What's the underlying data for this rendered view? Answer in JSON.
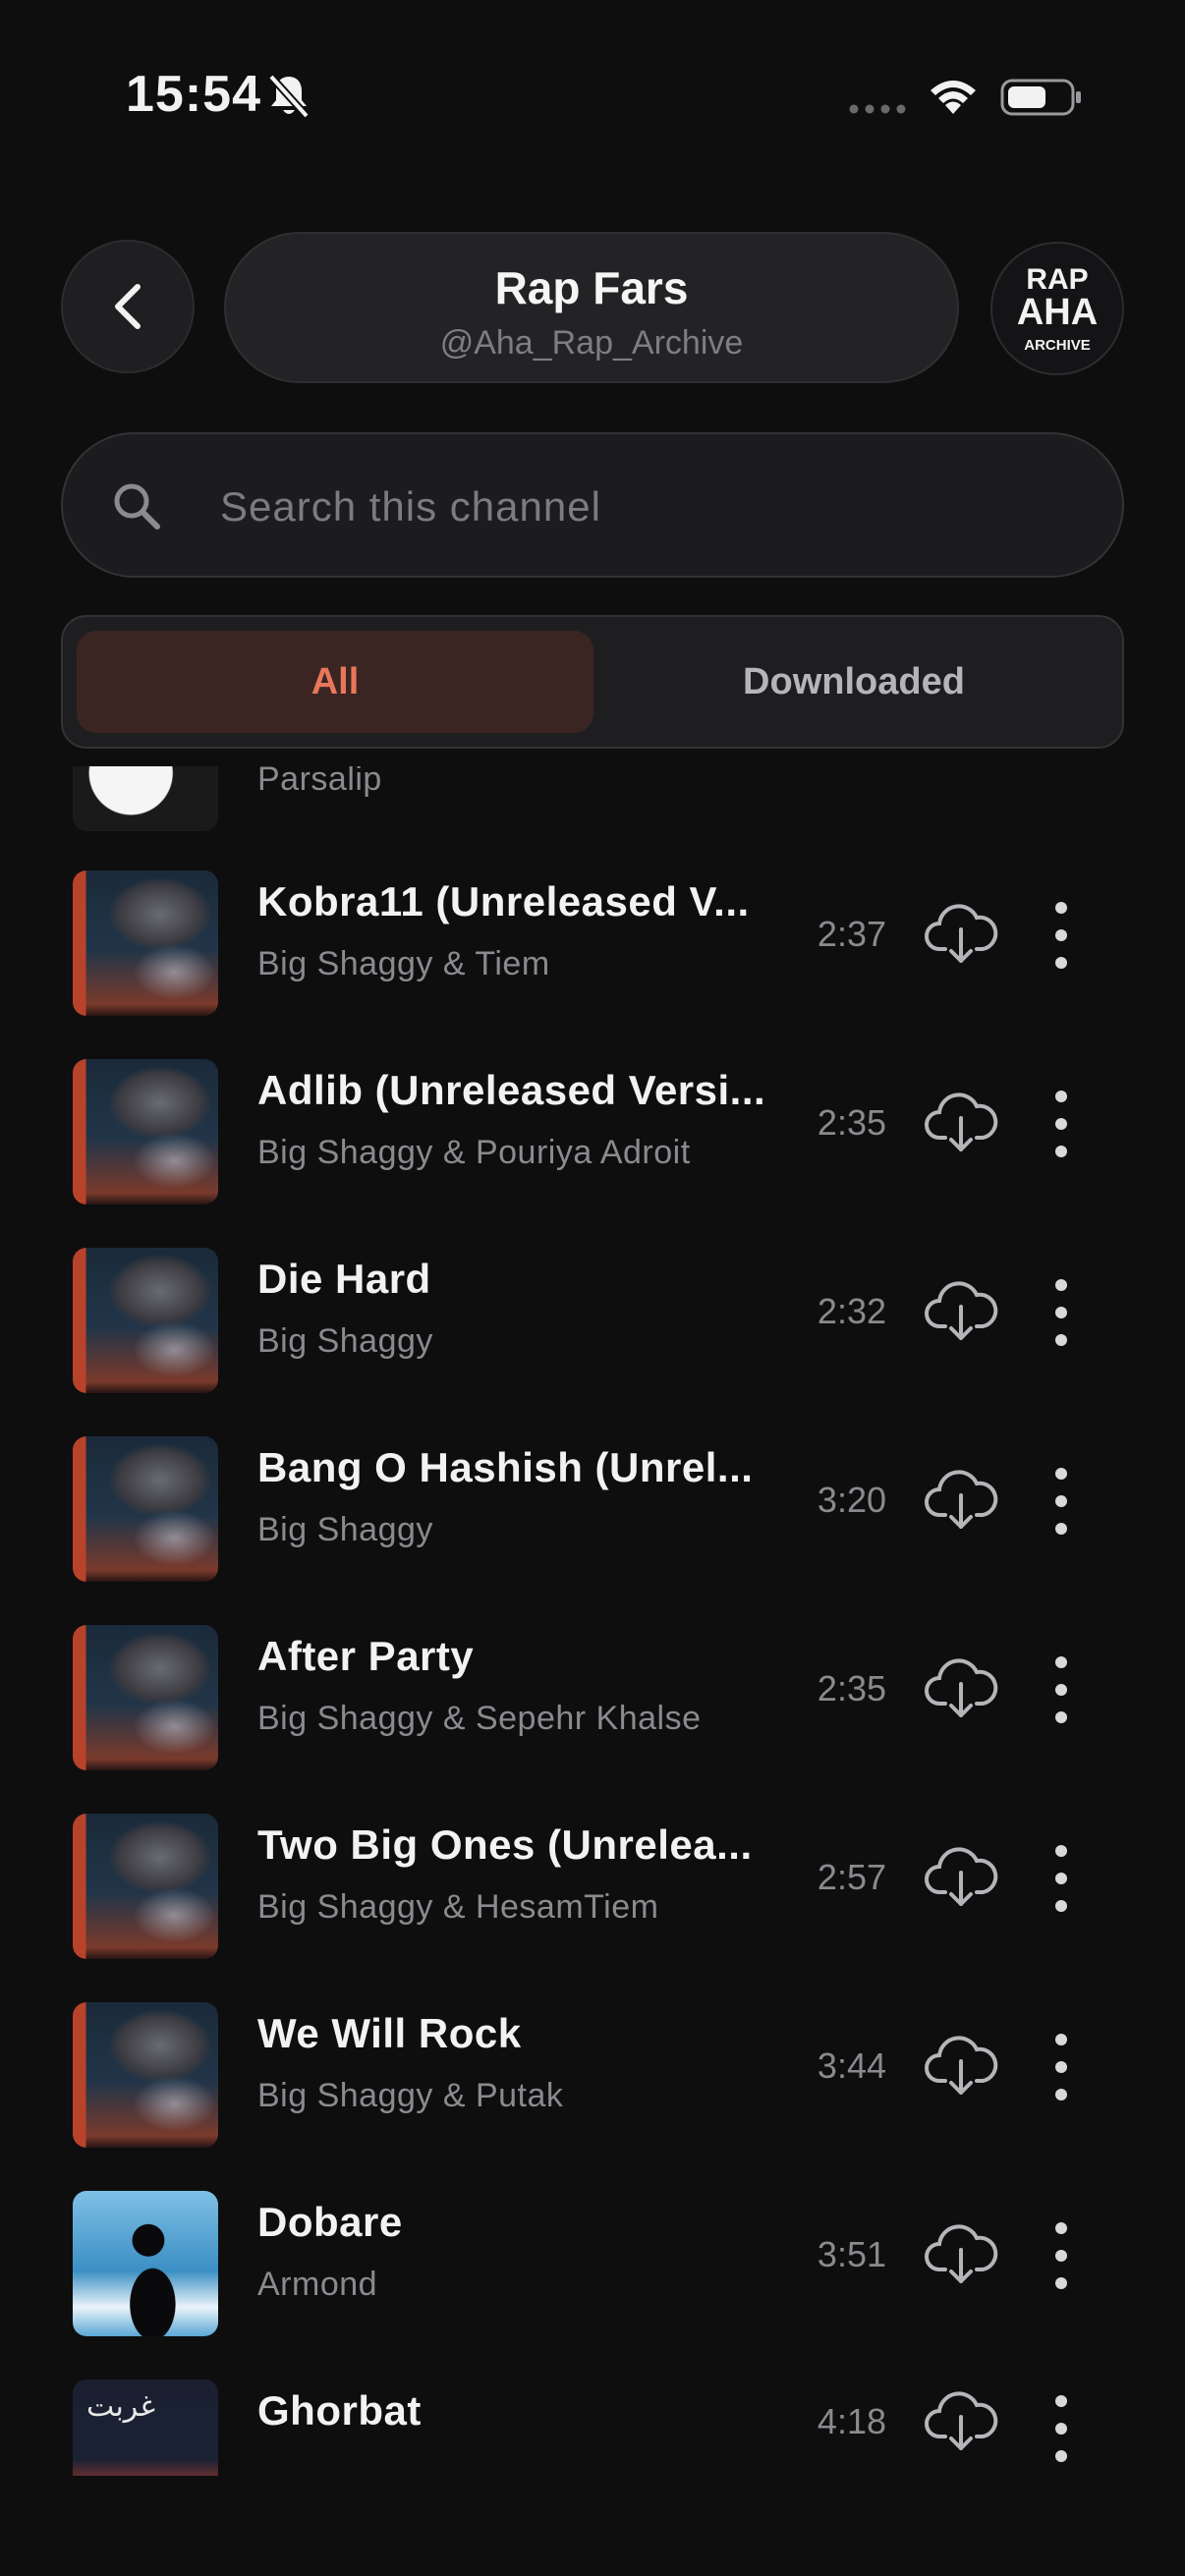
{
  "status_bar": {
    "time": "15:54"
  },
  "header": {
    "title": "Rap Fars",
    "handle": "@Aha_Rap_Archive",
    "avatar_text_top": "RAP",
    "avatar_text_mid": "AHA",
    "avatar_text_bottom": "ARCHIVE"
  },
  "search": {
    "placeholder": "Search this channel"
  },
  "tabs": {
    "all": "All",
    "downloaded": "Downloaded"
  },
  "colors": {
    "accent": "#e8765a",
    "accent_bg": "#3a2523",
    "background": "#0e0e0f"
  },
  "songs": [
    {
      "title": "",
      "artist": "Parsalip",
      "duration": "",
      "art": "white"
    },
    {
      "title": "Kobra11 (Unreleased V...",
      "artist": "Big Shaggy & Tiem",
      "duration": "2:37",
      "art": "hat"
    },
    {
      "title": "Adlib (Unreleased Versi...",
      "artist": "Big Shaggy & Pouriya Adroit",
      "duration": "2:35",
      "art": "hat"
    },
    {
      "title": "Die Hard",
      "artist": "Big Shaggy",
      "duration": "2:32",
      "art": "hat"
    },
    {
      "title": "Bang O Hashish (Unrel...",
      "artist": "Big Shaggy",
      "duration": "3:20",
      "art": "hat"
    },
    {
      "title": "After Party",
      "artist": "Big Shaggy & Sepehr Khalse",
      "duration": "2:35",
      "art": "hat"
    },
    {
      "title": "Two Big Ones (Unrelea...",
      "artist": "Big Shaggy & HesamTiem",
      "duration": "2:57",
      "art": "hat"
    },
    {
      "title": "We Will Rock",
      "artist": "Big Shaggy & Putak",
      "duration": "3:44",
      "art": "hat"
    },
    {
      "title": "Dobare",
      "artist": "Armond",
      "duration": "3:51",
      "art": "blue"
    },
    {
      "title": "Ghorbat",
      "artist": "",
      "duration": "4:18",
      "art": "red",
      "art_text": "غربت"
    }
  ]
}
